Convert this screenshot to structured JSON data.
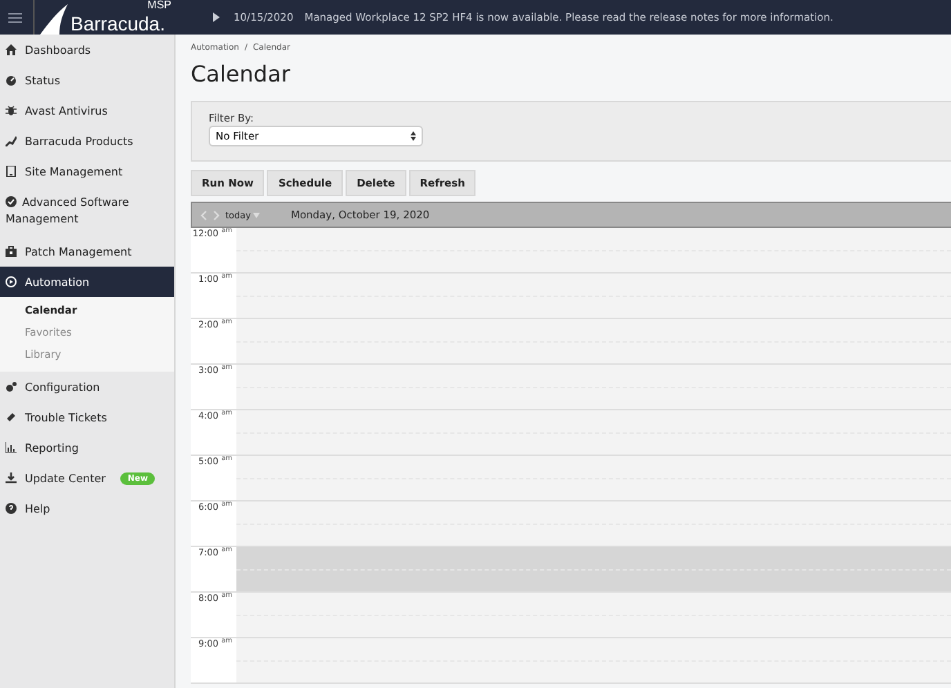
{
  "top_bar": {
    "logo_super": "MSP",
    "logo": "Barracuda.",
    "notice_date": "10/15/2020",
    "notice": "Managed Workplace 12 SP2 HF4 is now available. Please read the release notes for more information."
  },
  "sidebar": {
    "items": [
      {
        "label": "Dashboards",
        "selected": false
      },
      {
        "label": "Status",
        "selected": false
      },
      {
        "label": "Avast Antivirus",
        "selected": false
      },
      {
        "label": "Barracuda Products",
        "selected": false
      },
      {
        "label": "Site Management",
        "selected": false
      },
      {
        "label": "Advanced Software Management",
        "selected": false
      },
      {
        "label": "Patch Management",
        "selected": false
      },
      {
        "label": "Automation",
        "selected": true,
        "children": [
          {
            "label": "Calendar",
            "selected": true
          },
          {
            "label": "Favorites",
            "selected": false
          },
          {
            "label": "Library",
            "selected": false
          }
        ]
      },
      {
        "label": "Configuration",
        "selected": false
      },
      {
        "label": "Trouble Tickets",
        "selected": false
      },
      {
        "label": "Reporting",
        "selected": false
      },
      {
        "label": "Update Center",
        "selected": false,
        "badge": "New"
      },
      {
        "label": "Help",
        "selected": false
      }
    ]
  },
  "breadcrumb": [
    "Automation",
    "Calendar"
  ],
  "breadcrumb_separator": "/",
  "title": "Calendar",
  "filter": {
    "label": "Filter By:",
    "value": "No Filter"
  },
  "buttons": [
    "Run Now",
    "Schedule",
    "Delete",
    "Refresh"
  ],
  "calendar": {
    "today": "today",
    "date": "Monday, October 19, 2020",
    "hours": [
      {
        "time": "12:00",
        "meridiem": "am",
        "highlighted": false
      },
      {
        "time": "1:00",
        "meridiem": "am",
        "highlighted": false
      },
      {
        "time": "2:00",
        "meridiem": "am",
        "highlighted": false
      },
      {
        "time": "3:00",
        "meridiem": "am",
        "highlighted": false
      },
      {
        "time": "4:00",
        "meridiem": "am",
        "highlighted": false
      },
      {
        "time": "5:00",
        "meridiem": "am",
        "highlighted": false
      },
      {
        "time": "6:00",
        "meridiem": "am",
        "highlighted": false
      },
      {
        "time": "7:00",
        "meridiem": "am",
        "highlighted": true
      },
      {
        "time": "8:00",
        "meridiem": "am",
        "highlighted": false
      },
      {
        "time": "9:00",
        "meridiem": "am",
        "highlighted": false
      }
    ]
  }
}
